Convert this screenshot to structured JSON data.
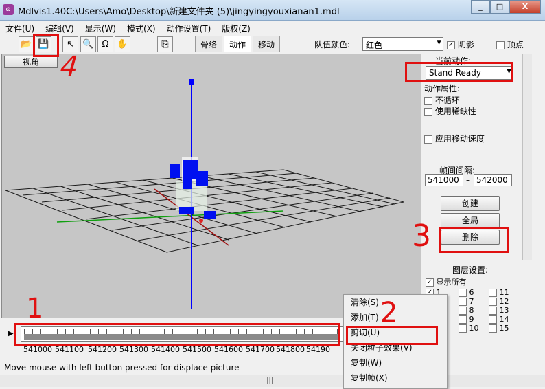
{
  "window": {
    "title": "Mdlvis1.40C:\\Users\\Amo\\Desktop\\新建文件夹 (5)\\jingyingyouxianan1.mdl",
    "minimize": "_",
    "maximize": "□",
    "close": "X"
  },
  "menu": [
    "文件(U)",
    "编辑(V)",
    "显示(W)",
    "模式(X)",
    "动作设置(T)",
    "版权(Z)"
  ],
  "toolbar": {
    "tabs": [
      "骨络",
      "动作",
      "移动"
    ],
    "team_color_label": "队伍颜色:",
    "team_color_value": "红色",
    "shadow_label": "阴影",
    "vertex_label": "顶点"
  },
  "viewport": {
    "view_button": "视角"
  },
  "panel": {
    "current_action_label": "当前动作:",
    "current_action_value": "Stand Ready",
    "action_props_label": "动作属性:",
    "no_loop_label": "不循环",
    "use_rarity_label": "使用稀缺性",
    "apply_move_speed_label": "应用移动速度",
    "frame_interval_label": "帧间间隔:",
    "frame_start": "541000",
    "frame_dash": "–",
    "frame_end": "542000",
    "create_button": "创建",
    "global_button": "全局",
    "delete_button": "删除"
  },
  "layers": {
    "header": "图层设置:",
    "show_all": "显示所有",
    "items": [
      "1",
      "6",
      "11",
      "7",
      "12",
      "8",
      "13",
      "9",
      "14",
      "10",
      "15"
    ]
  },
  "timeline": {
    "labels": [
      "541000",
      "541100",
      "541200",
      "541300",
      "541400",
      "541500",
      "541600",
      "541700",
      "541800",
      "54190"
    ]
  },
  "status": "Move mouse with left button pressed for displace  picture",
  "context_menu": [
    "清除(S)",
    "添加(T)",
    "剪切(U)",
    "关闭粒子效果(V)",
    "复制(W)",
    "复制帧(X)"
  ],
  "annotations": [
    "4",
    "3",
    "2",
    "1"
  ],
  "colors": {
    "annotation_red": "#e01010",
    "axis_blue": "#0000ff"
  }
}
